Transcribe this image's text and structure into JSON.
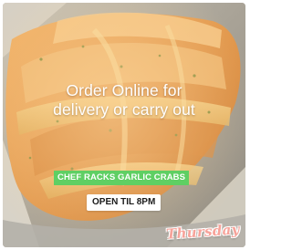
{
  "post": {
    "headline_line1": "Order Online for",
    "headline_line2": "delivery or carry out",
    "green_sticker": "CHEF RACKS GARLIC CRABS",
    "white_sticker": "OPEN TIL 8PM",
    "day_sticker": "Thursday"
  },
  "colors": {
    "green_sticker_bg": "#5fcf63",
    "day_sticker_text": "#f7a39a",
    "headline_text": "#ffffff"
  }
}
